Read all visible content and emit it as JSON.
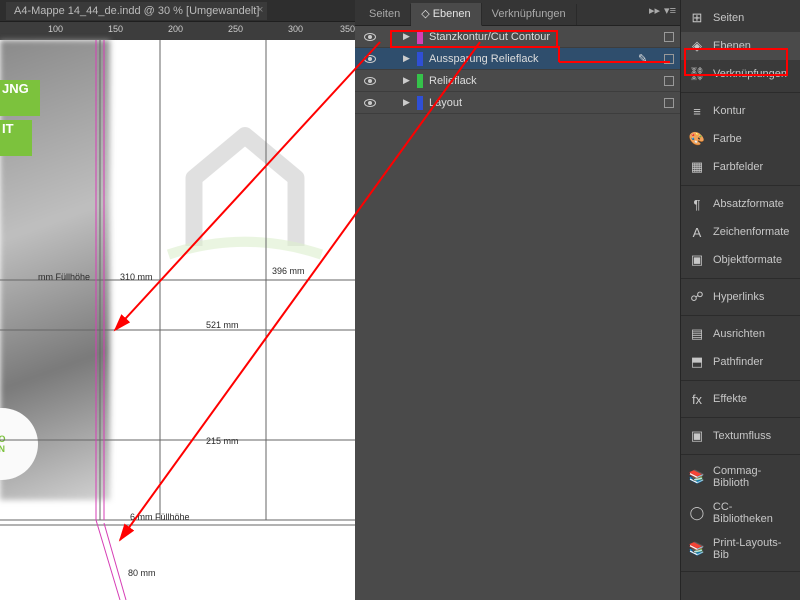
{
  "doc_tab": {
    "title": "A4-Mappe 14_44_de.indd @ 30 % [Umgewandelt]"
  },
  "ruler": {
    "ticks": [
      "100",
      "150",
      "200",
      "250",
      "300",
      "350"
    ]
  },
  "green_text": {
    "line1": "JNG",
    "line2": "IT"
  },
  "dimensions": {
    "fill_label": "mm Füllhöhe",
    "d310": "310 mm",
    "d396": "396 mm",
    "d521": "521 mm",
    "d215": "215 mm",
    "fold6": "6 mm Füllhöhe",
    "d80": "80 mm"
  },
  "panel_tabs": {
    "seiten": "Seiten",
    "ebenen": "Ebenen",
    "verknuepf": "Verknüpfungen"
  },
  "layers": [
    {
      "name": "Stanzkontur/Cut Contour",
      "color": "#d63eb6",
      "selected": false,
      "pen": false
    },
    {
      "name": "Aussparung Relieflack",
      "color": "#2f4fd6",
      "selected": true,
      "pen": true
    },
    {
      "name": "Relieflack",
      "color": "#35c24a",
      "selected": false,
      "pen": false
    },
    {
      "name": "Layout",
      "color": "#2f4fd6",
      "selected": false,
      "pen": false
    }
  ],
  "dock": {
    "groups": [
      [
        {
          "key": "seiten",
          "label": "Seiten",
          "icon": "⊞"
        },
        {
          "key": "ebenen",
          "label": "Ebenen",
          "icon": "◈",
          "active": true
        },
        {
          "key": "verknuepfungen",
          "label": "Verknüpfungen",
          "icon": "⛓"
        }
      ],
      [
        {
          "key": "kontur",
          "label": "Kontur",
          "icon": "≡"
        },
        {
          "key": "farbe",
          "label": "Farbe",
          "icon": "🎨"
        },
        {
          "key": "farbfelder",
          "label": "Farbfelder",
          "icon": "▦"
        }
      ],
      [
        {
          "key": "absatzformate",
          "label": "Absatzformate",
          "icon": "¶"
        },
        {
          "key": "zeichenformate",
          "label": "Zeichenformate",
          "icon": "A"
        },
        {
          "key": "objektformate",
          "label": "Objektformate",
          "icon": "▣"
        }
      ],
      [
        {
          "key": "hyperlinks",
          "label": "Hyperlinks",
          "icon": "☍"
        }
      ],
      [
        {
          "key": "ausrichten",
          "label": "Ausrichten",
          "icon": "▤"
        },
        {
          "key": "pathfinder",
          "label": "Pathfinder",
          "icon": "⬒"
        }
      ],
      [
        {
          "key": "effekte",
          "label": "Effekte",
          "icon": "fx"
        }
      ],
      [
        {
          "key": "textumfluss",
          "label": "Textumfluss",
          "icon": "▣"
        }
      ],
      [
        {
          "key": "commag",
          "label": "Commag-Biblioth",
          "icon": "📚"
        },
        {
          "key": "cc",
          "label": "CC-Bibliotheken",
          "icon": "◯"
        },
        {
          "key": "printlayouts",
          "label": "Print-Layouts-Bib",
          "icon": "📚"
        }
      ]
    ]
  }
}
